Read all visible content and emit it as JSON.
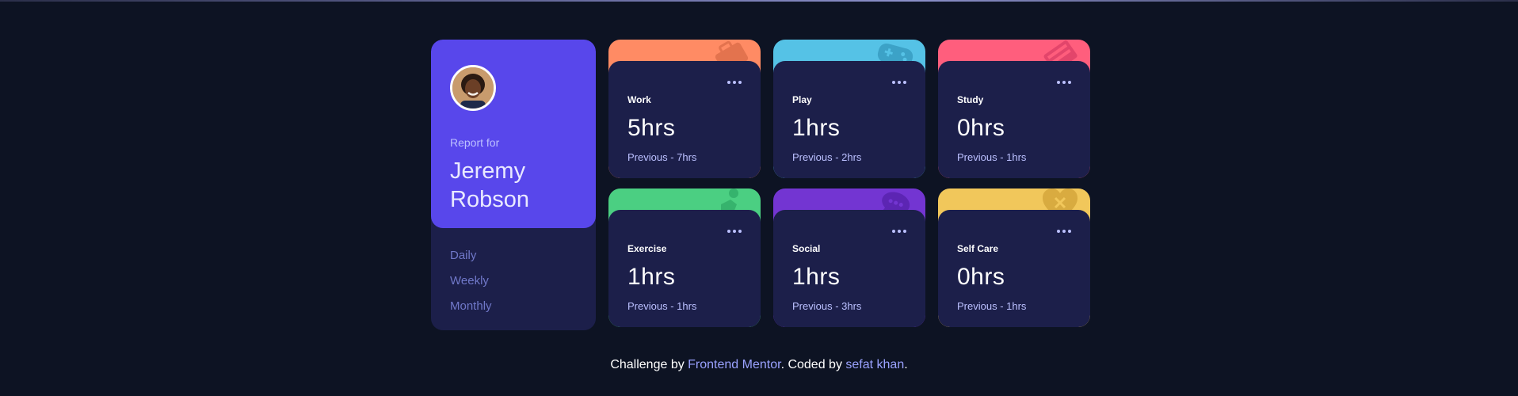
{
  "profile": {
    "report_for": "Report for",
    "name": "Jeremy Robson",
    "periods": [
      "Daily",
      "Weekly",
      "Monthly"
    ]
  },
  "cards": [
    {
      "title": "Work",
      "hours": "5hrs",
      "previous": "Previous - 7hrs",
      "color": "#ff8b64",
      "icon": "briefcase-icon"
    },
    {
      "title": "Play",
      "hours": "1hrs",
      "previous": "Previous - 2hrs",
      "color": "#55c2e6",
      "icon": "gamepad-icon"
    },
    {
      "title": "Study",
      "hours": "0hrs",
      "previous": "Previous - 1hrs",
      "color": "#ff5e7d",
      "icon": "book-icon"
    },
    {
      "title": "Exercise",
      "hours": "1hrs",
      "previous": "Previous - 1hrs",
      "color": "#4bcf82",
      "icon": "runner-icon"
    },
    {
      "title": "Social",
      "hours": "1hrs",
      "previous": "Previous - 3hrs",
      "color": "#7335d2",
      "icon": "chat-icon"
    },
    {
      "title": "Self Care",
      "hours": "0hrs",
      "previous": "Previous - 1hrs",
      "color": "#f1c75b",
      "icon": "heart-icon"
    }
  ],
  "footer": {
    "prefix": "Challenge by ",
    "link1": "Frontend Mentor",
    "middle": ". Coded by ",
    "link2": "sefat khan",
    "suffix": "."
  }
}
